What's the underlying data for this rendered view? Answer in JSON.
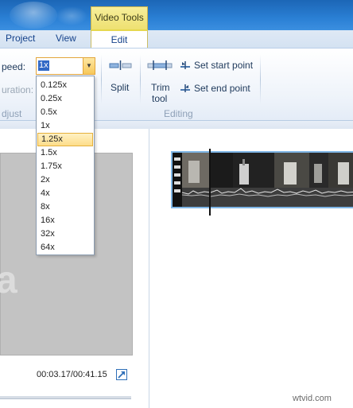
{
  "title_bar": {
    "context_tab": "Video Tools"
  },
  "tabs": [
    {
      "label": "Project"
    },
    {
      "label": "View"
    },
    {
      "label": "Edit"
    }
  ],
  "ribbon": {
    "speed_label": "peed:",
    "speed_value": "1x",
    "duration_label": "uration:",
    "adjust_group": "djust",
    "split_label": "Split",
    "trim_label_1": "Trim",
    "trim_label_2": "tool",
    "set_start_label": "Set start point",
    "set_end_label": "Set end point",
    "editing_group": "Editing"
  },
  "speed_options": [
    "0.125x",
    "0.25x",
    "0.5x",
    "1x",
    "1.25x",
    "1.5x",
    "1.75x",
    "2x",
    "4x",
    "8x",
    "16x",
    "32x",
    "64x"
  ],
  "speed_selected_index": 4,
  "preview": {
    "letter": "a",
    "time": "00:03.17/00:41.15"
  },
  "watermark": "wtvid.com",
  "colors": {
    "title_bar": "#2a7fd4",
    "context_tab": "#f2e77f",
    "accent_orange": "#e3a53b",
    "clip_border": "#7fb6e6"
  }
}
